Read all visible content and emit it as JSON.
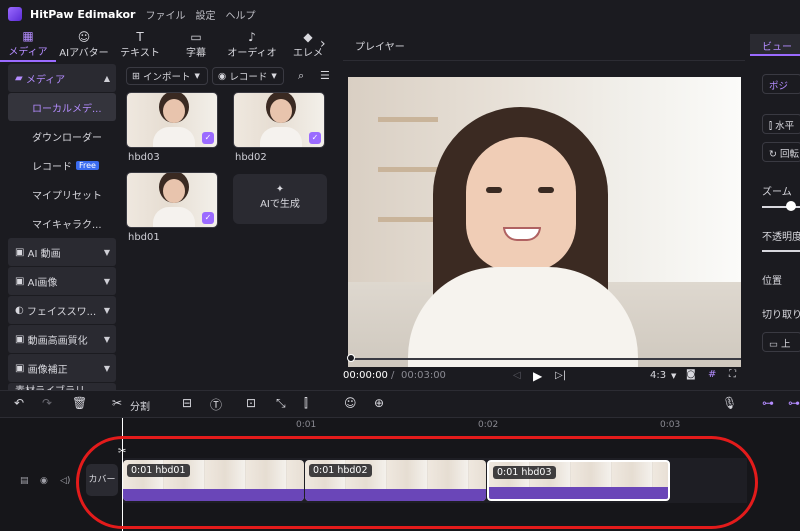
{
  "app": {
    "name": "HitPaw Edimakor",
    "menu": [
      "ファイル",
      "設定",
      "ヘルプ"
    ]
  },
  "top_tabs": [
    {
      "label": "メディア",
      "icon": "media-icon",
      "glyph": "▦",
      "active": true
    },
    {
      "label": "AIアバター",
      "icon": "ai-avatar-icon",
      "glyph": "☺"
    },
    {
      "label": "テキスト",
      "icon": "text-icon",
      "glyph": "T"
    },
    {
      "label": "字幕",
      "icon": "subtitle-icon",
      "glyph": "▭"
    },
    {
      "label": "オーディオ",
      "icon": "audio-icon",
      "glyph": "♪"
    },
    {
      "label": "エレメ",
      "icon": "element-icon",
      "glyph": "◆"
    }
  ],
  "sidebar": {
    "media": "メディア",
    "local_media": "ローカルメデ...",
    "downloader": "ダウンローダー",
    "record": "レコード",
    "free_badge": "Free",
    "my_presets": "マイプリセット",
    "my_characters": "マイキャラク...",
    "ai_video": "AI 動画",
    "ai_image": "AI画像",
    "face_swap": "フェイススワ...",
    "video_enhance": "動画高画質化",
    "image_correct": "画像補正",
    "asset_library": "素材ライブラリ"
  },
  "media_panel": {
    "import": "インポート",
    "record": "レコード",
    "items": [
      "hbd03",
      "hbd02",
      "hbd01"
    ],
    "ai_generate": "AIで生成"
  },
  "player": {
    "title": "プレイヤー",
    "time_current": "00:00:00",
    "time_total": "00:03:00",
    "aspect": "4:3"
  },
  "right_panel": {
    "tab": "ビュー",
    "tab2": "ポジ",
    "flip_h": "水平",
    "rotate": "回転",
    "zoom": "ズーム",
    "opacity": "不透明度",
    "position": "位置",
    "crop": "切り取り",
    "up": "上"
  },
  "toolbar": {
    "split": "分割"
  },
  "timeline": {
    "ticks": [
      "0:01",
      "0:02",
      "0:03"
    ],
    "cover": "カバー",
    "clips": [
      {
        "label": "0:01 hbd01"
      },
      {
        "label": "0:01 hbd02"
      },
      {
        "label": "0:01 hbd03"
      }
    ]
  }
}
